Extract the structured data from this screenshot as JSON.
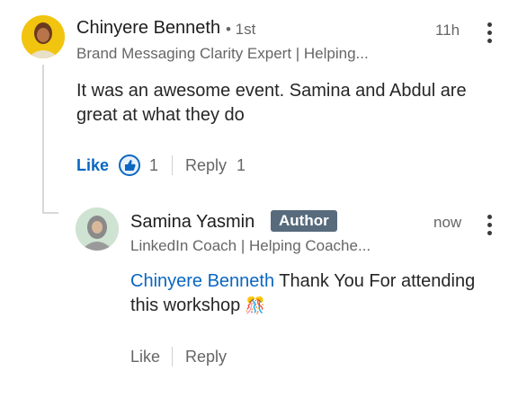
{
  "comment": {
    "author_name": "Chinyere Benneth",
    "degree": "• 1st",
    "headline": "Brand Messaging Clarity Expert | Helping...",
    "time": "11h",
    "text": "It was an awesome event. Samina and Abdul are great at what they do",
    "like_label": "Like",
    "reaction_icon": "thumbs-up-icon",
    "reaction_count": "1",
    "reply_label": "Reply",
    "reply_count": "1"
  },
  "reply": {
    "author_name": "Samina Yasmin",
    "author_badge": "Author",
    "headline": "LinkedIn Coach | Helping Coache...",
    "time": "now",
    "mention": "Chinyere Benneth",
    "text_line1": " Thank You For attending",
    "text_line2": "this workshop",
    "emoji": "🎊",
    "like_label": "Like",
    "reply_label": "Reply"
  },
  "colors": {
    "accent": "#0a66c2",
    "author_badge": "#586b7d",
    "muted_text": "#666666"
  }
}
